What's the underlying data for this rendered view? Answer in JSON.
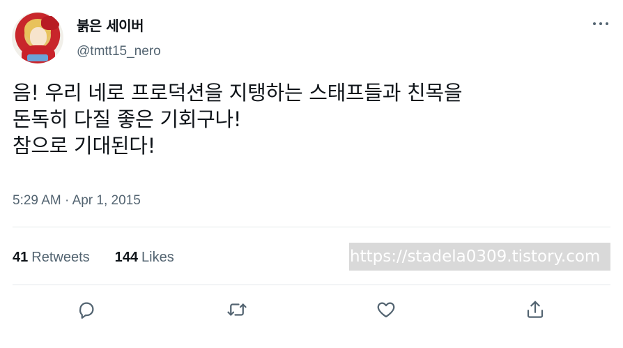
{
  "author": {
    "display_name": "붉은 세이버",
    "handle": "@tmtt15_nero",
    "avatar": "avatar-image"
  },
  "tweet": {
    "lines": [
      "음! 우리 네로 프로덕션을 지탱하는 스태프들과 친목을",
      "돈독히 다질 좋은 기회구나!",
      "참으로 기대된다!"
    ],
    "time": "5:29 AM",
    "separator": "·",
    "date": "Apr 1, 2015"
  },
  "stats": {
    "retweets_count": "41",
    "retweets_label": "Retweets",
    "likes_count": "144",
    "likes_label": "Likes"
  },
  "watermark": "https://stadela0309.tistory.com",
  "icons": {
    "more": "more-horizontal-icon",
    "reply": "reply-icon",
    "retweet": "retweet-icon",
    "like": "heart-icon",
    "share": "share-icon"
  },
  "colors": {
    "text_primary": "#0f1419",
    "text_secondary": "#536471",
    "divider": "#e3e7ea",
    "watermark_bg": "#d9d9d9"
  }
}
